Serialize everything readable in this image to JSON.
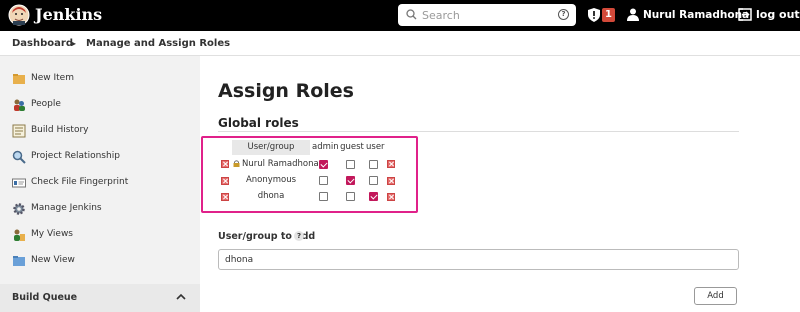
{
  "header": {
    "brand": "Jenkins",
    "search_placeholder": "Search",
    "search_help": "?",
    "notification_count": "1",
    "user_name": "Nurul Ramadhona",
    "logout_label": "log out",
    "accent_color": "#d24939"
  },
  "breadcrumb": {
    "items": [
      "Dashboard",
      "Manage and Assign Roles"
    ]
  },
  "sidebar": {
    "items": [
      {
        "label": "New Item",
        "icon": "new-item-icon"
      },
      {
        "label": "People",
        "icon": "people-icon"
      },
      {
        "label": "Build History",
        "icon": "build-history-icon"
      },
      {
        "label": "Project Relationship",
        "icon": "project-relationship-icon"
      },
      {
        "label": "Check File Fingerprint",
        "icon": "fingerprint-icon"
      },
      {
        "label": "Manage Jenkins",
        "icon": "gear-icon"
      },
      {
        "label": "My Views",
        "icon": "my-views-icon"
      },
      {
        "label": "New View",
        "icon": "new-view-icon"
      }
    ],
    "build_queue_label": "Build Queue"
  },
  "main": {
    "title": "Assign Roles",
    "section_title": "Global roles",
    "table": {
      "headers": [
        "User/group",
        "admin",
        "guest",
        "user"
      ],
      "rows": [
        {
          "name": "Nurul Ramadhona",
          "admin": true,
          "guest": false,
          "user": false
        },
        {
          "name": "Anonymous",
          "admin": false,
          "guest": true,
          "user": false
        },
        {
          "name": "dhona",
          "admin": false,
          "guest": false,
          "user": true
        }
      ]
    },
    "add_label": "User/group to add",
    "add_help": "?",
    "add_value": "dhona",
    "add_button": "Add"
  }
}
